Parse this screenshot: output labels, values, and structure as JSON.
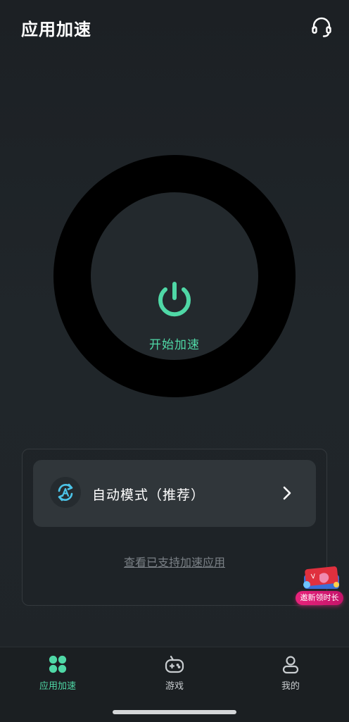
{
  "header": {
    "title": "应用加速",
    "support_icon": "headset-icon"
  },
  "power": {
    "icon": "power-icon",
    "label": "开始加速",
    "accent_color": "#4fd8a6"
  },
  "mode": {
    "icon": "auto-mode-icon",
    "label": "自动模式（推荐）",
    "chevron_icon": "chevron-right-icon"
  },
  "supported_link": "查看已支持加速应用",
  "invite": {
    "label": "邀新领时长",
    "icon": "gift-card-icon"
  },
  "bottom_nav": {
    "items": [
      {
        "label": "应用加速",
        "icon": "app-grid-icon",
        "active": true
      },
      {
        "label": "游戏",
        "icon": "gamepad-icon",
        "active": false
      },
      {
        "label": "我的",
        "icon": "profile-icon",
        "active": false
      }
    ]
  }
}
